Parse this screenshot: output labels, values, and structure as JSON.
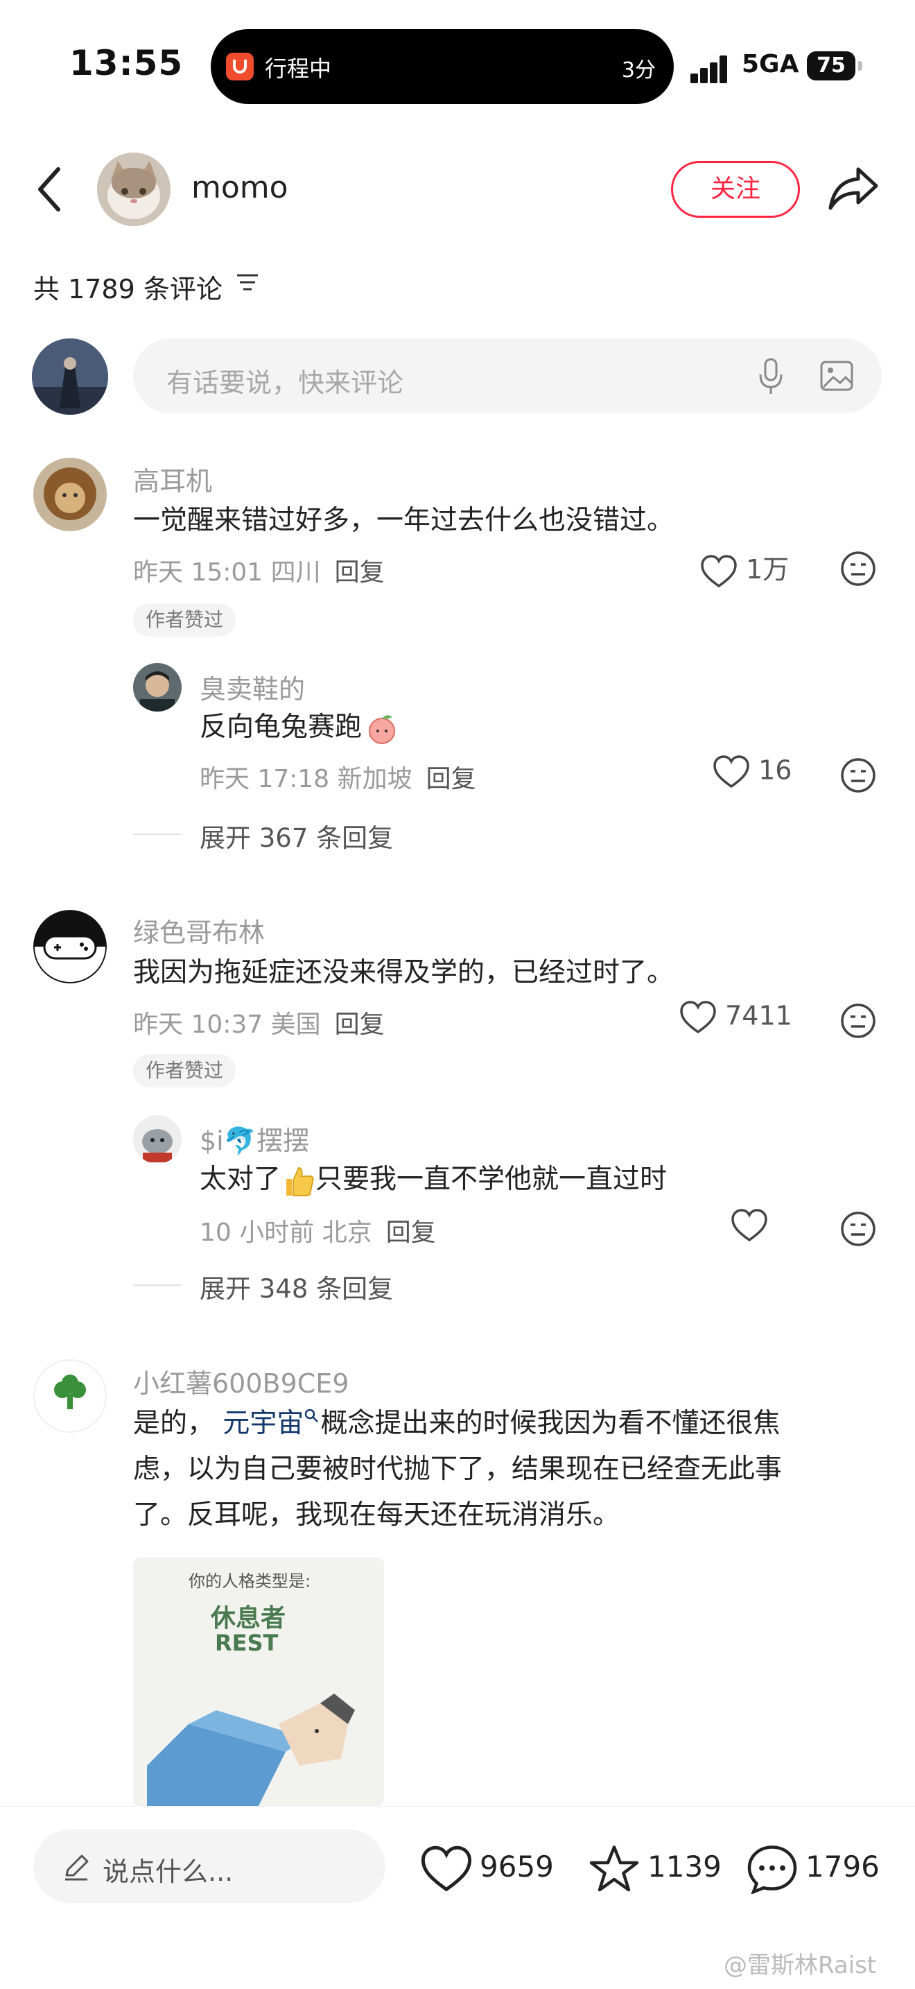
{
  "status_bar": {
    "time": "13:55",
    "activity_label": "行程中",
    "activity_right": "3分",
    "network": "5GA",
    "battery": "75"
  },
  "header": {
    "username": "momo",
    "follow_label": "关注"
  },
  "comments_header": {
    "count_text": "共 1789 条评论"
  },
  "input": {
    "placeholder": "有话要说，快来评论"
  },
  "comments": [
    {
      "name": "高耳机",
      "text": "一觉醒来错过好多，一年过去什么也没错过。",
      "meta": "昨天 15:01 四川",
      "reply_label": "回复",
      "likes": "1万",
      "badge": "作者赞过",
      "sub": {
        "name": "臭卖鞋的",
        "text": "反向龟兔赛跑",
        "meta": "昨天 17:18 新加坡",
        "reply_label": "回复",
        "likes": "16"
      },
      "expand": "展开 367 条回复"
    },
    {
      "name": "绿色哥布林",
      "text": "我因为拖延症还没来得及学的，已经过时了。",
      "meta": "昨天 10:37 美国",
      "reply_label": "回复",
      "likes": "7411",
      "badge": "作者赞过",
      "sub": {
        "name": "$i🐬摆摆",
        "text_a": "太对了",
        "text_b": "只要我一直不学他就一直过时",
        "meta": "10 小时前 北京",
        "reply_label": "回复",
        "likes": ""
      },
      "expand": "展开 348 条回复"
    },
    {
      "name": "小红薯600B9CE9",
      "text_pre": "是的，",
      "link": "元宇宙",
      "text_post": "概念提出来的时候我因为看不懂还很焦",
      "text_line2": "虑，以为自己要被时代抛下了，结果现在已经查无此事",
      "text_line3": "了。反耳呢，我现在每天还在玩消消乐。",
      "card": {
        "line1": "你的人格类型是:",
        "line2": "休息者",
        "line3": "REST"
      }
    }
  ],
  "bottom": {
    "say_label": "说点什么...",
    "likes": "9659",
    "stars": "1139",
    "comments": "1796"
  },
  "watermark": "@雷斯林Raist",
  "colors": {
    "accent": "#ff2442",
    "link": "#13386c"
  }
}
